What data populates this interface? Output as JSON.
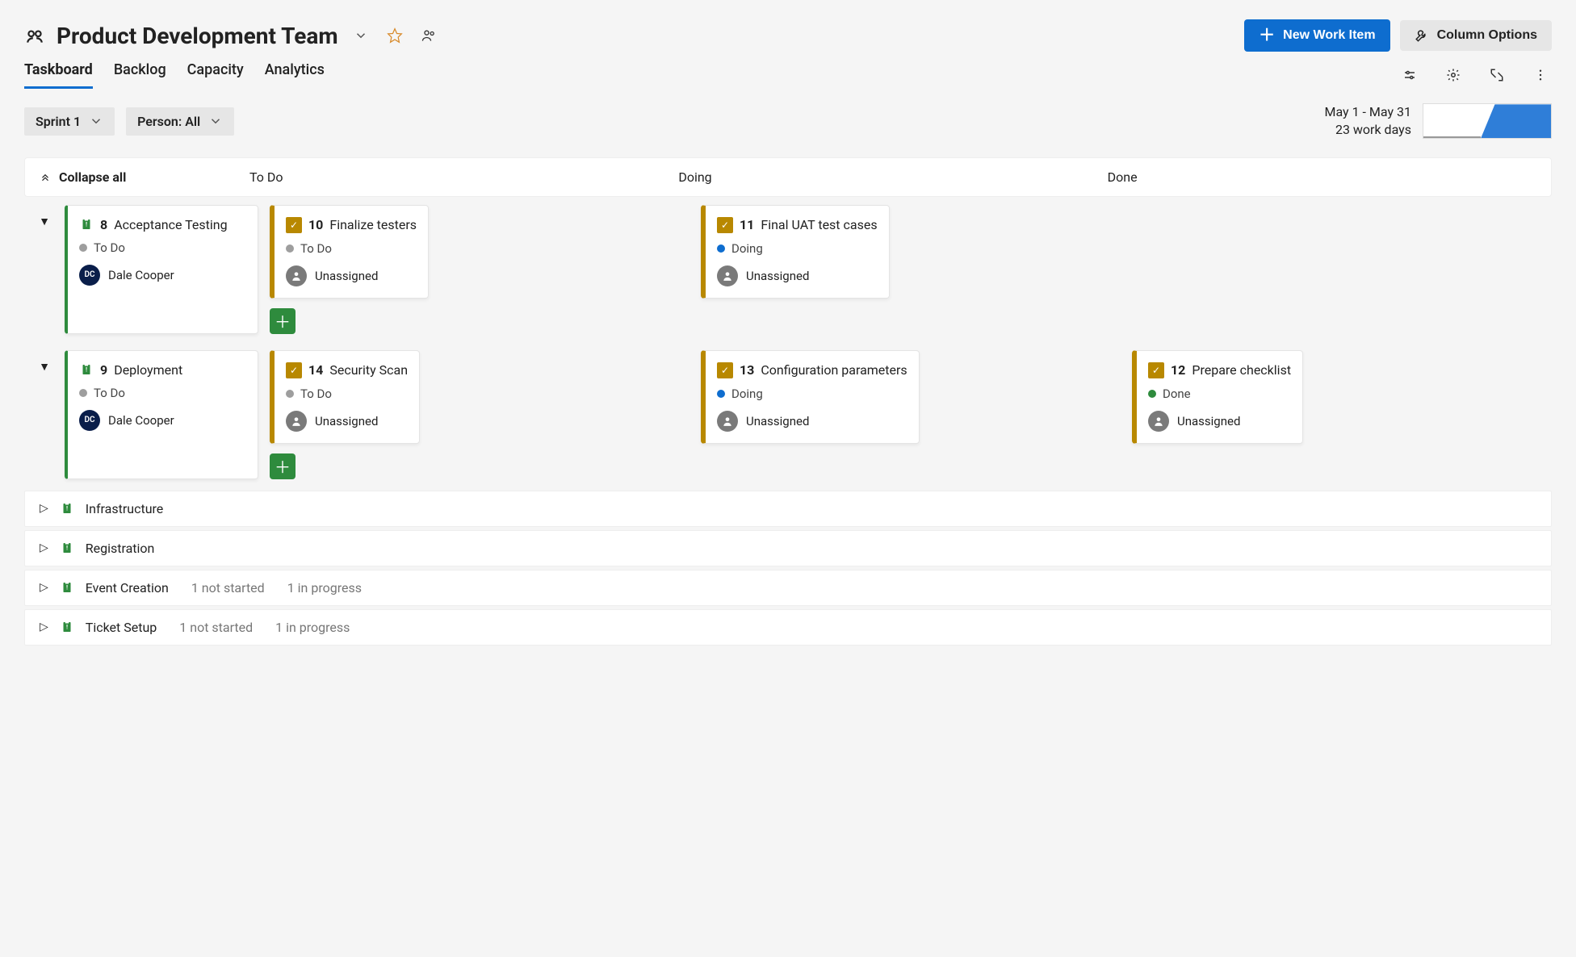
{
  "header": {
    "page_title": "Product Development Team",
    "new_work_item": "New Work Item",
    "column_options": "Column Options"
  },
  "tabs": {
    "taskboard": "Taskboard",
    "backlog": "Backlog",
    "capacity": "Capacity",
    "analytics": "Analytics"
  },
  "filters": {
    "sprint": "Sprint 1",
    "person_label": "Person: All"
  },
  "sprint_info": {
    "date_range": "May 1 - May 31",
    "work_days": "23 work days"
  },
  "columns": {
    "collapse_all": "Collapse all",
    "todo": "To Do",
    "doing": "Doing",
    "done": "Done"
  },
  "swimlanes": [
    {
      "parent": {
        "id": "8",
        "title": "Acceptance Testing",
        "status": "To Do",
        "assignee": "Dale Cooper",
        "initials": "DC"
      },
      "todo": {
        "id": "10",
        "title": "Finalize testers",
        "status": "To Do",
        "assignee": "Unassigned"
      },
      "doing": {
        "id": "11",
        "title": "Final UAT test cases",
        "status": "Doing",
        "assignee": "Unassigned"
      },
      "done": null
    },
    {
      "parent": {
        "id": "9",
        "title": "Deployment",
        "status": "To Do",
        "assignee": "Dale Cooper",
        "initials": "DC"
      },
      "todo": {
        "id": "14",
        "title": "Security Scan",
        "status": "To Do",
        "assignee": "Unassigned"
      },
      "doing": {
        "id": "13",
        "title": "Configuration parameters",
        "status": "Doing",
        "assignee": "Unassigned"
      },
      "done": {
        "id": "12",
        "title": "Prepare checklist",
        "status": "Done",
        "assignee": "Unassigned"
      }
    }
  ],
  "collapsed": [
    {
      "title": "Infrastructure",
      "meta1": "",
      "meta2": ""
    },
    {
      "title": "Registration",
      "meta1": "",
      "meta2": ""
    },
    {
      "title": "Event Creation",
      "meta1": "1 not started",
      "meta2": "1 in progress"
    },
    {
      "title": "Ticket Setup",
      "meta1": "1 not started",
      "meta2": "1 in progress"
    }
  ]
}
